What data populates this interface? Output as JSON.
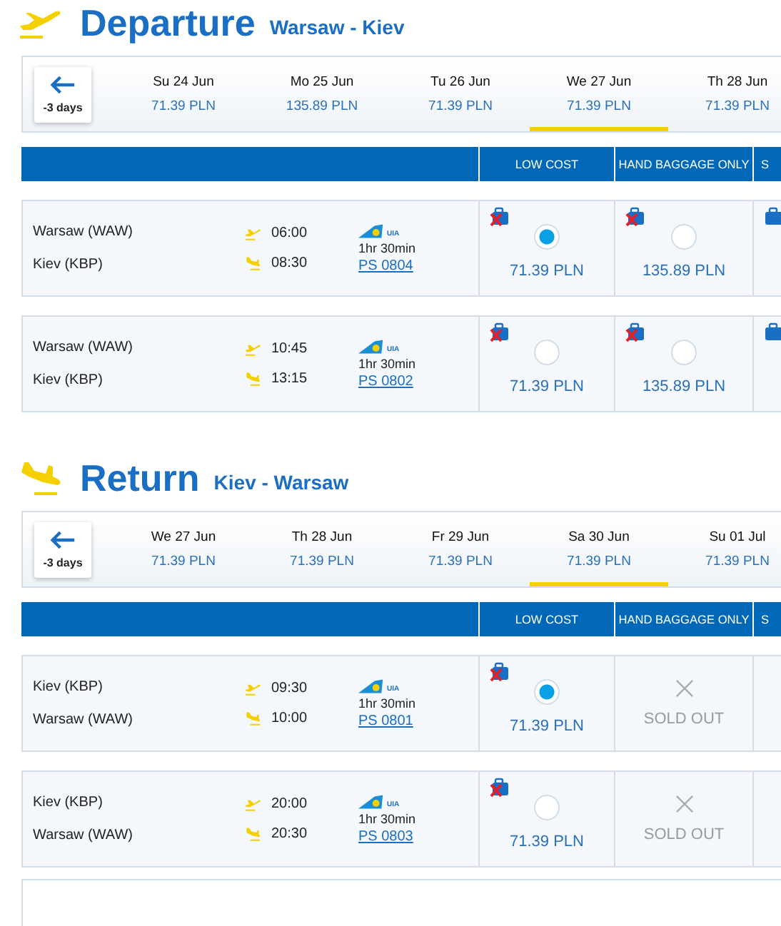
{
  "sections": [
    {
      "kind": "departure",
      "title": "Departure",
      "route": "Warsaw - Kiev",
      "back_label": "-3 days",
      "dates": [
        {
          "day": "Su 24 Jun",
          "price": "71.39 PLN",
          "selected": false
        },
        {
          "day": "Mo 25 Jun",
          "price": "135.89 PLN",
          "selected": false
        },
        {
          "day": "Tu 26 Jun",
          "price": "71.39 PLN",
          "selected": false
        },
        {
          "day": "We 27 Jun",
          "price": "71.39 PLN",
          "selected": true
        },
        {
          "day": "Th 28 Jun",
          "price": "71.39 PLN",
          "selected": false
        }
      ],
      "columns": [
        "LOW COST",
        "HAND BAGGAGE ONLY",
        "S"
      ],
      "flights": [
        {
          "from": "Warsaw (WAW)",
          "to": "Kiev (KBP)",
          "dep": "06:00",
          "arr": "08:30",
          "airline": "UIA",
          "duration": "1hr 30min",
          "number": "PS 0804",
          "fares": [
            {
              "kind": "available",
              "baggage_included": false,
              "selected": true,
              "price": "71.39 PLN"
            },
            {
              "kind": "available",
              "baggage_included": false,
              "selected": false,
              "price": "135.89 PLN"
            },
            {
              "kind": "cut",
              "baggage_included": true
            }
          ]
        },
        {
          "from": "Warsaw (WAW)",
          "to": "Kiev (KBP)",
          "dep": "10:45",
          "arr": "13:15",
          "airline": "UIA",
          "duration": "1hr 30min",
          "number": "PS 0802",
          "fares": [
            {
              "kind": "available",
              "baggage_included": false,
              "selected": false,
              "price": "71.39 PLN"
            },
            {
              "kind": "available",
              "baggage_included": false,
              "selected": false,
              "price": "135.89 PLN"
            },
            {
              "kind": "cut",
              "baggage_included": true
            }
          ]
        }
      ]
    },
    {
      "kind": "return",
      "title": "Return",
      "route": "Kiev - Warsaw",
      "back_label": "-3 days",
      "dates": [
        {
          "day": "We 27 Jun",
          "price": "71.39 PLN",
          "selected": false
        },
        {
          "day": "Th 28 Jun",
          "price": "71.39 PLN",
          "selected": false
        },
        {
          "day": "Fr 29 Jun",
          "price": "71.39 PLN",
          "selected": false
        },
        {
          "day": "Sa 30 Jun",
          "price": "71.39 PLN",
          "selected": true
        },
        {
          "day": "Su 01 Jul",
          "price": "71.39 PLN",
          "selected": false
        }
      ],
      "columns": [
        "LOW COST",
        "HAND BAGGAGE ONLY",
        "S"
      ],
      "flights": [
        {
          "from": "Kiev (KBP)",
          "to": "Warsaw (WAW)",
          "dep": "09:30",
          "arr": "10:00",
          "airline": "UIA",
          "duration": "1hr 30min",
          "number": "PS 0801",
          "fares": [
            {
              "kind": "available",
              "baggage_included": false,
              "selected": true,
              "price": "71.39 PLN"
            },
            {
              "kind": "soldout",
              "label": "SOLD OUT"
            },
            {
              "kind": "blank"
            }
          ]
        },
        {
          "from": "Kiev (KBP)",
          "to": "Warsaw (WAW)",
          "dep": "20:00",
          "arr": "20:30",
          "airline": "UIA",
          "duration": "1hr 30min",
          "number": "PS 0803",
          "fares": [
            {
              "kind": "available",
              "baggage_included": false,
              "selected": false,
              "price": "71.39 PLN"
            },
            {
              "kind": "soldout",
              "label": "SOLD OUT"
            },
            {
              "kind": "blank"
            }
          ]
        }
      ]
    }
  ]
}
